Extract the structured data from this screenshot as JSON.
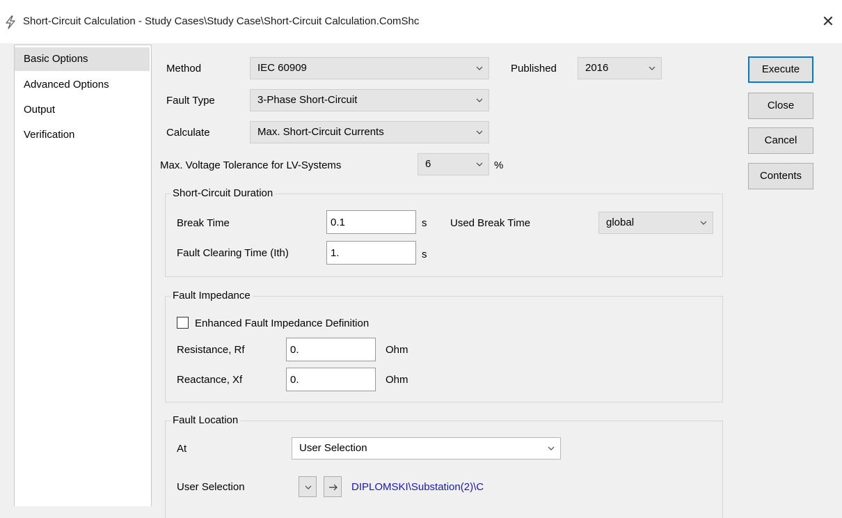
{
  "window": {
    "title": "Short-Circuit Calculation - Study Cases\\Study Case\\Short-Circuit Calculation.ComShc",
    "icon": "lightning-icon",
    "close_icon": "close-icon"
  },
  "nav": {
    "items": [
      {
        "label": "Basic Options",
        "selected": true
      },
      {
        "label": "Advanced Options",
        "selected": false
      },
      {
        "label": "Output",
        "selected": false
      },
      {
        "label": "Verification",
        "selected": false
      }
    ]
  },
  "form": {
    "method": {
      "label": "Method",
      "value": "IEC 60909"
    },
    "published": {
      "label": "Published",
      "value": "2016"
    },
    "fault_type": {
      "label": "Fault Type",
      "value": "3-Phase Short-Circuit"
    },
    "calculate": {
      "label": "Calculate",
      "value": "Max. Short-Circuit Currents"
    },
    "voltage_tolerance": {
      "label": "Max. Voltage Tolerance for LV-Systems",
      "value": "6",
      "unit": "%"
    }
  },
  "duration": {
    "title": "Short-Circuit Duration",
    "break_time": {
      "label": "Break Time",
      "value": "0.1",
      "unit": "s"
    },
    "used_break_time": {
      "label": "Used Break Time",
      "value": "global"
    },
    "fault_clearing": {
      "label": "Fault Clearing Time (Ith)",
      "value": "1.",
      "unit": "s"
    }
  },
  "impedance": {
    "title": "Fault Impedance",
    "enhanced": {
      "label": "Enhanced Fault Impedance Definition",
      "checked": false
    },
    "resistance": {
      "label": "Resistance, Rf",
      "value": "0.",
      "unit": "Ohm"
    },
    "reactance": {
      "label": "Reactance, Xf",
      "value": "0.",
      "unit": "Ohm"
    }
  },
  "location": {
    "title": "Fault Location",
    "at": {
      "label": "At",
      "value": "User Selection"
    },
    "user_selection": {
      "label": "User Selection",
      "link": "DIPLOMSKI\\Substation(2)\\C"
    }
  },
  "buttons": {
    "execute": "Execute",
    "close": "Close",
    "cancel": "Cancel",
    "contents": "Contents"
  },
  "colors": {
    "accent": "#0078d7",
    "link": "#1a1aa6"
  }
}
